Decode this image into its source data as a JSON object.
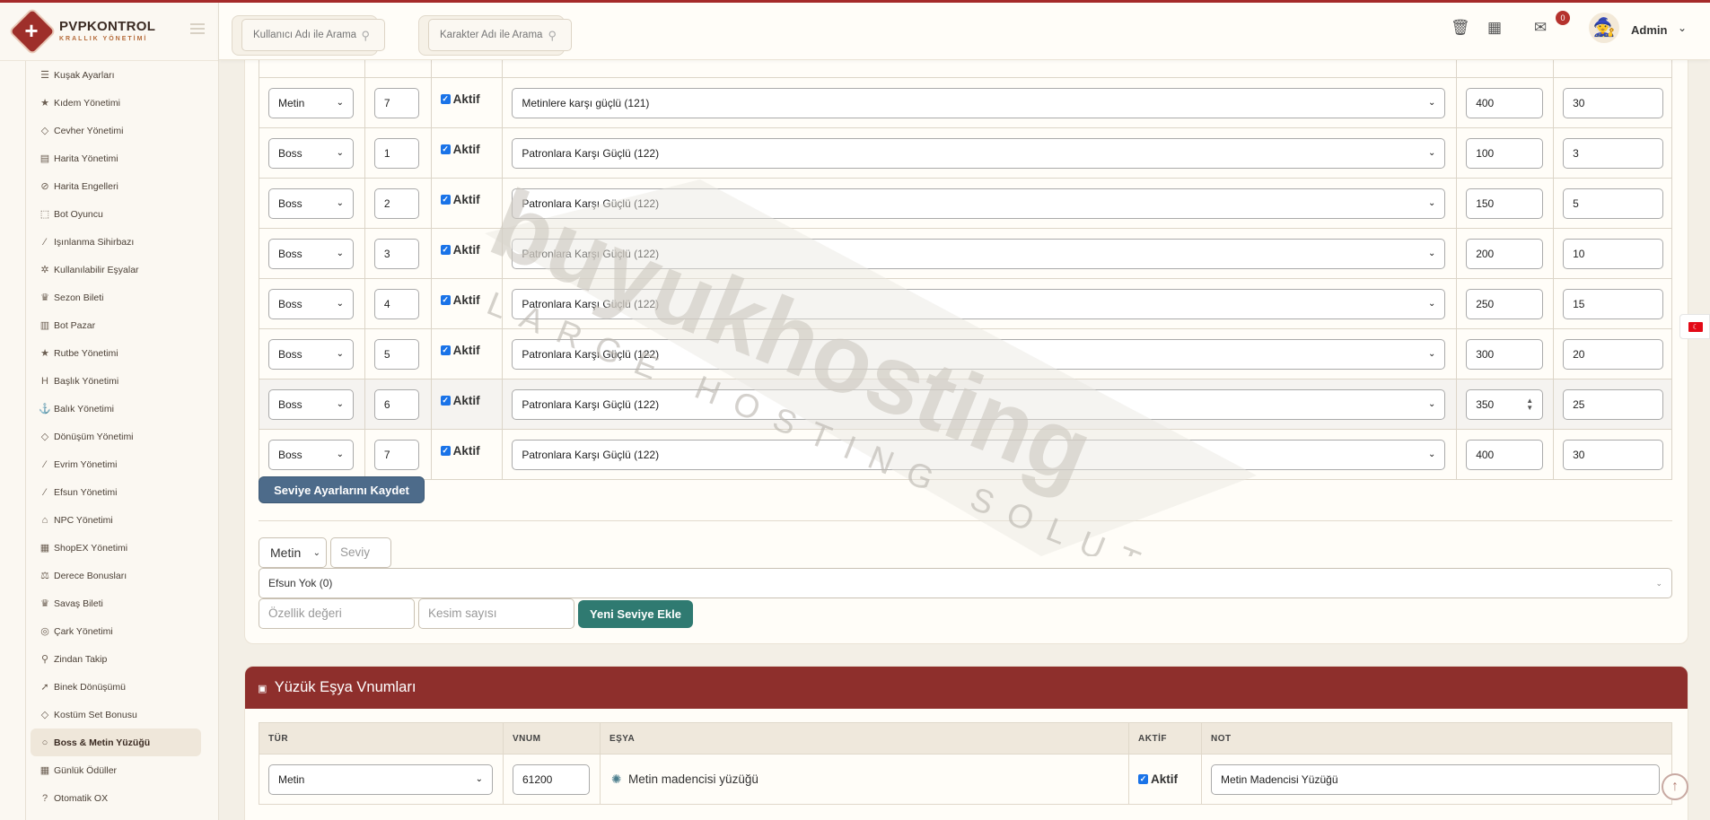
{
  "brand": {
    "name": "PVPKONTROL",
    "subtitle": "KRALLIK YÖNETİMİ"
  },
  "header": {
    "search_user_placeholder": "Kullanıcı Adı ile Arama",
    "search_char_placeholder": "Karakter Adı ile Arama",
    "notification_count": "0",
    "user_name": "Admin"
  },
  "sidebar": {
    "items": [
      {
        "label": "Kuşak Ayarları",
        "icon": "sliders-icon"
      },
      {
        "label": "Kıdem Yönetimi",
        "icon": "star-icon"
      },
      {
        "label": "Cevher Yönetimi",
        "icon": "gem-icon"
      },
      {
        "label": "Harita Yönetimi",
        "icon": "map-icon"
      },
      {
        "label": "Harita Engelleri",
        "icon": "ban-icon"
      },
      {
        "label": "Bot Oyuncu",
        "icon": "android-icon"
      },
      {
        "label": "Işınlanma Sihirbazı",
        "icon": "magic-wand-icon"
      },
      {
        "label": "Kullanılabilir Eşyalar",
        "icon": "cogs-icon"
      },
      {
        "label": "Sezon Bileti",
        "icon": "trophy-icon"
      },
      {
        "label": "Bot Pazar",
        "icon": "shop-icon"
      },
      {
        "label": "Rutbe Yönetimi",
        "icon": "star-icon"
      },
      {
        "label": "Başlık Yönetimi",
        "icon": "heading-icon"
      },
      {
        "label": "Balık Yönetimi",
        "icon": "anchor-icon"
      },
      {
        "label": "Dönüşüm Yönetimi",
        "icon": "gem-icon"
      },
      {
        "label": "Evrim Yönetimi",
        "icon": "magic-wand-icon"
      },
      {
        "label": "Efsun Yönetimi",
        "icon": "magic-wand-icon"
      },
      {
        "label": "NPC Yönetimi",
        "icon": "bank-icon"
      },
      {
        "label": "ShopEX Yönetimi",
        "icon": "store-icon"
      },
      {
        "label": "Derece Bonusları",
        "icon": "balance-scale-icon"
      },
      {
        "label": "Savaş Bileti",
        "icon": "trophy-icon"
      },
      {
        "label": "Çark Yönetimi",
        "icon": "wheel-icon"
      },
      {
        "label": "Zindan Takip",
        "icon": "map-pin-icon"
      },
      {
        "label": "Binek Dönüşümü",
        "icon": "rocket-icon"
      },
      {
        "label": "Kostüm Set Bonusu",
        "icon": "gem-icon"
      },
      {
        "label": "Boss & Metin Yüzüğü",
        "icon": "circle-icon",
        "active": true
      },
      {
        "label": "Günlük Ödüller",
        "icon": "calendar-icon"
      },
      {
        "label": "Otomatik OX",
        "icon": "question-icon"
      }
    ]
  },
  "level_table": {
    "checkbox_label": "Aktif",
    "rows": [
      {
        "type": "Metin",
        "level": "7",
        "bonus": "Metinlere karşı güçlü (121)",
        "value": "400",
        "cuts": "30"
      },
      {
        "type": "Boss",
        "level": "1",
        "bonus": "Patronlara Karşı Güçlü (122)",
        "value": "100",
        "cuts": "3"
      },
      {
        "type": "Boss",
        "level": "2",
        "bonus": "Patronlara Karşı Güçlü (122)",
        "value": "150",
        "cuts": "5"
      },
      {
        "type": "Boss",
        "level": "3",
        "bonus": "Patronlara Karşı Güçlü (122)",
        "value": "200",
        "cuts": "10"
      },
      {
        "type": "Boss",
        "level": "4",
        "bonus": "Patronlara Karşı Güçlü (122)",
        "value": "250",
        "cuts": "15"
      },
      {
        "type": "Boss",
        "level": "5",
        "bonus": "Patronlara Karşı Güçlü (122)",
        "value": "300",
        "cuts": "20"
      },
      {
        "type": "Boss",
        "level": "6",
        "bonus": "Patronlara Karşı Güçlü (122)",
        "value": "350",
        "cuts": "25"
      },
      {
        "type": "Boss",
        "level": "7",
        "bonus": "Patronlara Karşı Güçlü (122)",
        "value": "400",
        "cuts": "30"
      }
    ],
    "save_button": "Seviye Ayarlarını Kaydet"
  },
  "new_level_form": {
    "type_value": "Metin",
    "level_placeholder": "Seviy",
    "bonus_value": "Efsun Yok (0)",
    "value_placeholder": "Özellik değeri",
    "cuts_placeholder": "Kesim sayısı",
    "add_button": "Yeni Seviye Ekle"
  },
  "ring_section": {
    "title": "Yüzük Eşya Vnumları",
    "columns": [
      "TÜR",
      "VNUM",
      "EŞYA",
      "AKTİF",
      "NOT"
    ],
    "rows": [
      {
        "type": "Metin",
        "vnum": "61200",
        "item": "Metin madencisi yüzüğü",
        "active": "Aktif",
        "note": "Metin Madencisi Yüzüğü"
      }
    ]
  },
  "watermark": {
    "line1": "buyukhosting",
    "line2": "LARGE HOSTING SOLUTIONS"
  },
  "colors": {
    "accent": "#8e2f2c",
    "save_button": "#4d6b8a",
    "add_button": "#2f7a71"
  }
}
